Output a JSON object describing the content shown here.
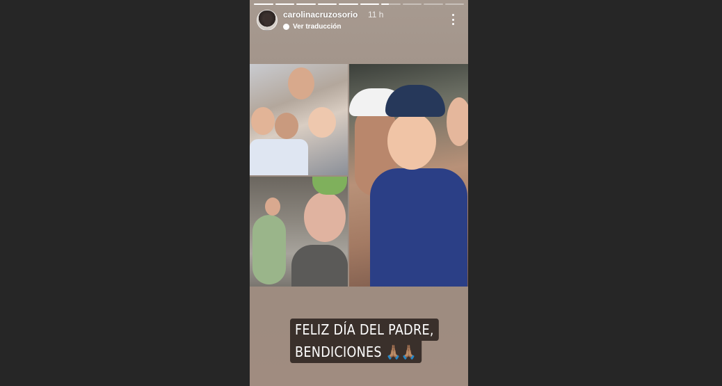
{
  "story": {
    "progress_segments": [
      1,
      1,
      1,
      1,
      1,
      1,
      0.4,
      0,
      0,
      0
    ],
    "colors": {
      "background": "#262626",
      "caption_bg": "#3a302b",
      "story_bg": "#a79a90"
    },
    "header": {
      "username": "carolinacruzosorio",
      "time": "11 h",
      "translate_label": "Ver traducción",
      "avatar_icon": "profile-avatar",
      "more_icon": "more-vertical-icon"
    },
    "caption": {
      "line1": "FELIZ DÍA DEL PADRE,",
      "line2": "BENDICIONES 🙏🏽🙏🏽"
    },
    "photos": [
      "family-photo-1",
      "family-photo-2",
      "family-photo-3"
    ]
  }
}
